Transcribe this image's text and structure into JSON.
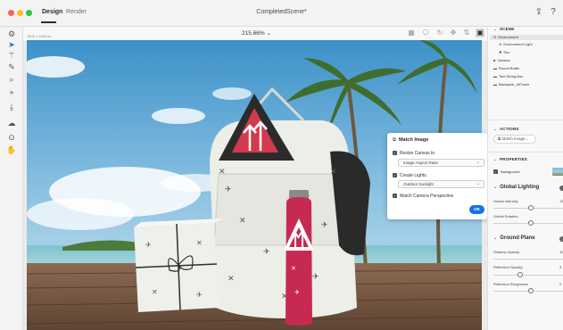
{
  "tabs": {
    "design": "Design",
    "render": "Render"
  },
  "document_title": "CompletedScene*",
  "colors": {
    "accent": "#1473e6",
    "selection": "#e6e6e6"
  },
  "toolbar": {
    "tools": [
      "settings-icon",
      "select-icon",
      "magic-wand-icon",
      "eyedropper-icon",
      "paint-icon",
      "add-icon",
      "download-icon",
      "cloud-icon",
      "zoom-icon",
      "pan-hand-icon"
    ]
  },
  "canvas": {
    "zoom": "215.66%",
    "size_label": "1500 x 1000 px"
  },
  "match_image": {
    "title": "Match Image",
    "resize_canvas_label": "Resize Canvas to",
    "resize_canvas_value": "Image Aspect Ratio",
    "create_lights_label": "Create Lights",
    "create_lights_value": "Outdoor Sunlight",
    "match_perspective_label": "Match Camera Perspective",
    "ok_label": "OK"
  },
  "panel": {
    "scene_title": "SCENE",
    "tree": [
      {
        "label": "Environment",
        "icon": "environment-icon"
      },
      {
        "label": "Environment Light",
        "icon": "light-icon"
      },
      {
        "label": "Sun",
        "icon": "sun-icon"
      },
      {
        "label": "Camera",
        "icon": "camera-icon"
      },
      {
        "label": "Round Bottle",
        "icon": "model-icon"
      },
      {
        "label": "Tied String Box",
        "icon": "model-icon"
      },
      {
        "label": "Backpack_InPouch",
        "icon": "model-icon"
      }
    ],
    "actions_title": "ACTIONS",
    "match_image_button": "Match Image...",
    "properties_title": "PROPERTIES",
    "background_label": "Background",
    "global_lighting_title": "Global Lighting",
    "global_intensity_label": "Global Intensity",
    "global_intensity_value": "13",
    "global_rotation_label": "Global Rotation",
    "ground_plane_title": "Ground Plane",
    "shadow_opacity_label": "Shadow Opacity",
    "shadow_opacity_value": "10",
    "reflection_opacity_label": "Reflection Opacity",
    "reflection_opacity_value": "3",
    "reflection_roughness_label": "Reflection Roughness",
    "reflection_roughness_value": "0"
  }
}
